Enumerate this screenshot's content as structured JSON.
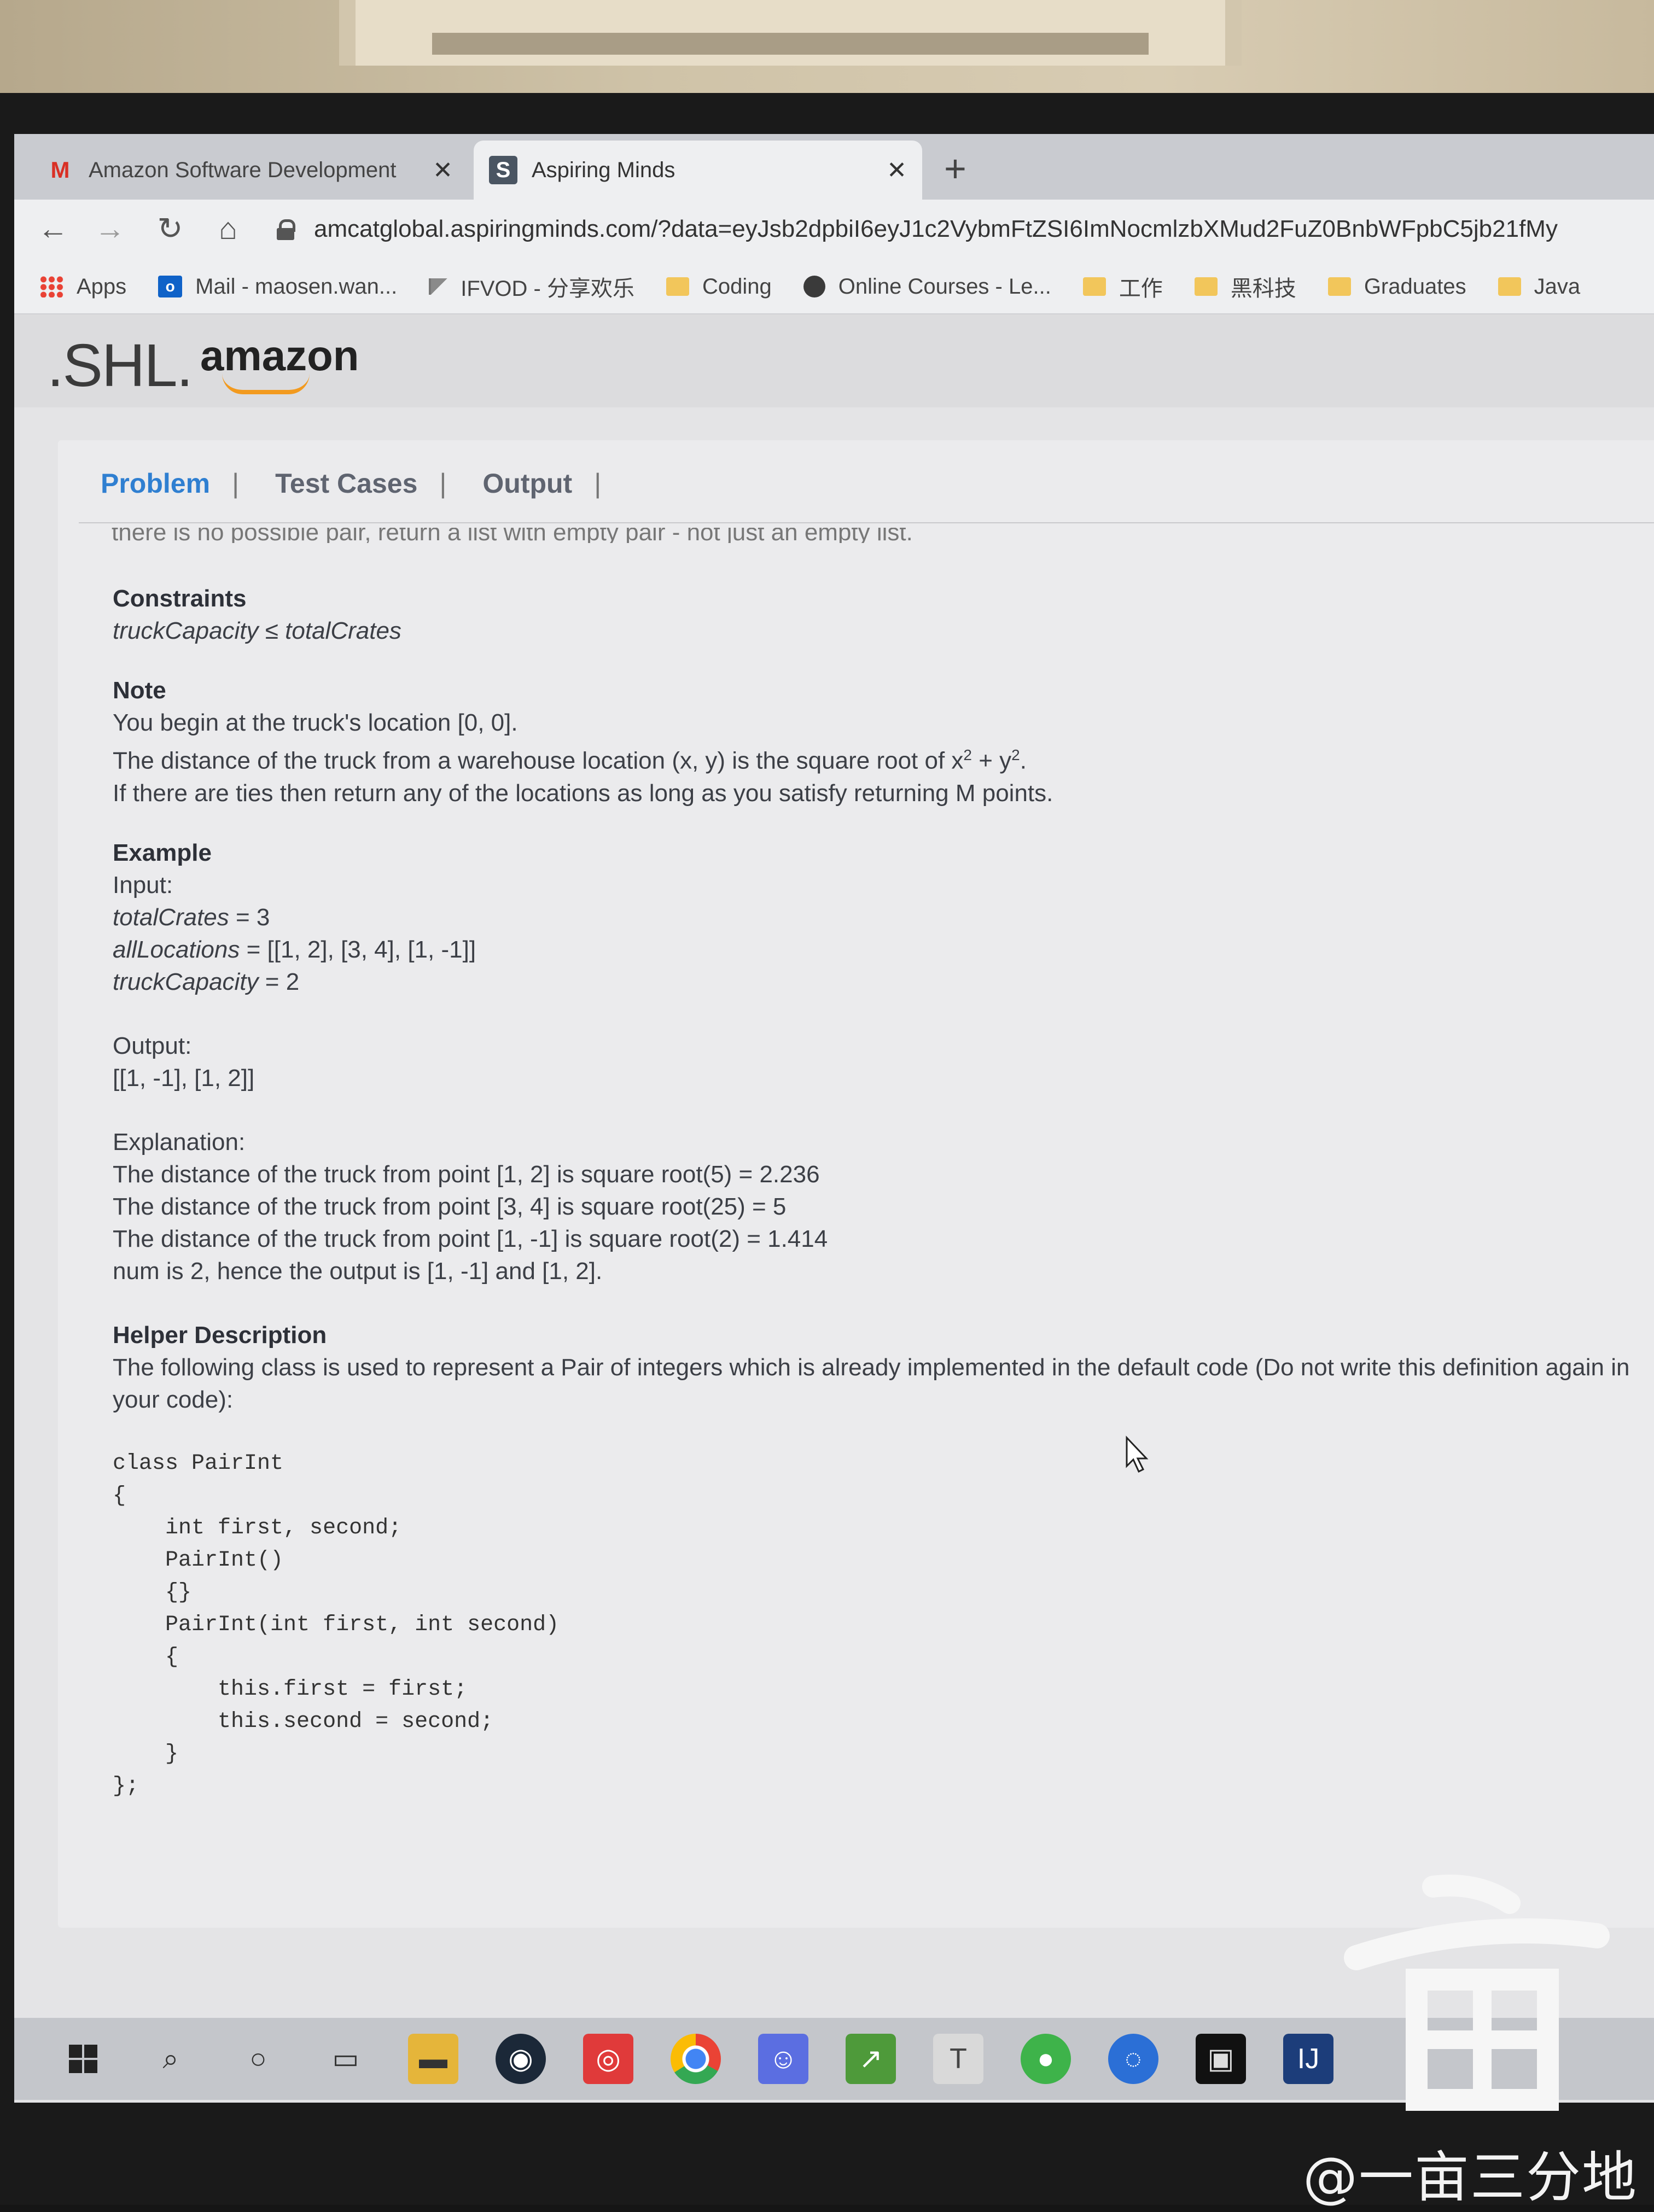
{
  "browser": {
    "tabs": [
      {
        "title": "Amazon Software Development",
        "icon": "gmail-icon",
        "active": false
      },
      {
        "title": "Aspiring Minds",
        "icon": "aspiring-minds-icon",
        "active": true
      }
    ],
    "url": "amcatglobal.aspiringminds.com/?data=eyJsb2dpbiI6eyJ1c2VybmFtZSI6ImNocmlzbXMud2FuZ0BnbWFpbC5jb21fMy",
    "bookmarks": [
      {
        "label": "Apps",
        "icon": "apps-grid-icon"
      },
      {
        "label": "Mail - maosen.wan...",
        "icon": "outlook-icon"
      },
      {
        "label": "IFVOD - 分享欢乐",
        "icon": "flag-icon"
      },
      {
        "label": "Coding",
        "icon": "folder-icon"
      },
      {
        "label": "Online Courses - Le...",
        "icon": "globe-icon"
      },
      {
        "label": "工作",
        "icon": "folder-icon"
      },
      {
        "label": "黑科技",
        "icon": "folder-icon"
      },
      {
        "label": "Graduates",
        "icon": "folder-icon"
      },
      {
        "label": "Java",
        "icon": "folder-icon"
      }
    ]
  },
  "header": {
    "brand": ".SHL.",
    "partner": "amazon"
  },
  "tabs": {
    "problem": "Problem",
    "test_cases": "Test Cases",
    "output": "Output",
    "sep": "|"
  },
  "problem": {
    "cut_line": "there is no possible pair, return a list with empty pair - not just an empty list.",
    "constraints_title": "Constraints",
    "constraint_lhs": "truckCapacity",
    "constraint_op": " ≤ ",
    "constraint_rhs": "totalCrates",
    "note_title": "Note",
    "note_1": "You begin at the truck's location [0, 0].",
    "note_2a": "The distance of the truck from a warehouse location (x, y) is the square root of x",
    "note_2b": "2",
    "note_2c": " + y",
    "note_2d": "2",
    "note_2e": ".",
    "note_3": "If there are ties then return any of the locations as long as you satisfy returning M points.",
    "example_title": "Example",
    "input_label": "Input:",
    "ex_var1": "totalCrates",
    "ex_val1": " = 3",
    "ex_var2": "allLocations",
    "ex_val2": " = [[1, 2], [3, 4], [1, -1]]",
    "ex_var3": "truckCapacity",
    "ex_val3": " = 2",
    "output_label": "Output:",
    "output_value": "[[1, -1], [1, 2]]",
    "explanation_label": "Explanation:",
    "expl_1": "The distance of the truck from point [1, 2] is square root(5) = 2.236",
    "expl_2": "The distance of the truck from point [3, 4] is square root(25) = 5",
    "expl_3": "The distance of the truck from point [1, -1] is square root(2) = 1.414",
    "expl_4": "num is 2, hence the output is [1, -1] and [1, 2].",
    "helper_title": "Helper Description",
    "helper_text": "The following class is used to represent a Pair of integers which is already implemented in the default code (Do not write this definition again in your code):",
    "code": "class PairInt\n{\n    int first, second;\n    PairInt()\n    {}\n    PairInt(int first, int second)\n    {\n        this.first = first;\n        this.second = second;\n    }\n};"
  },
  "taskbar": {
    "icons": [
      "windows-start-icon",
      "search-icon",
      "cortana-icon",
      "task-view-icon",
      "file-explorer-icon",
      "steam-icon",
      "netease-music-icon",
      "chrome-icon",
      "discord-icon",
      "chart-app-icon",
      "typora-icon",
      "wechat-icon",
      "copy-app-icon",
      "terminal-icon",
      "intellij-icon"
    ]
  },
  "watermark": {
    "text": "@一亩三分地"
  },
  "colors": {
    "accent": "#2f7fd1",
    "amazon_smile": "#f29a1f",
    "gmail_red": "#d93025"
  }
}
